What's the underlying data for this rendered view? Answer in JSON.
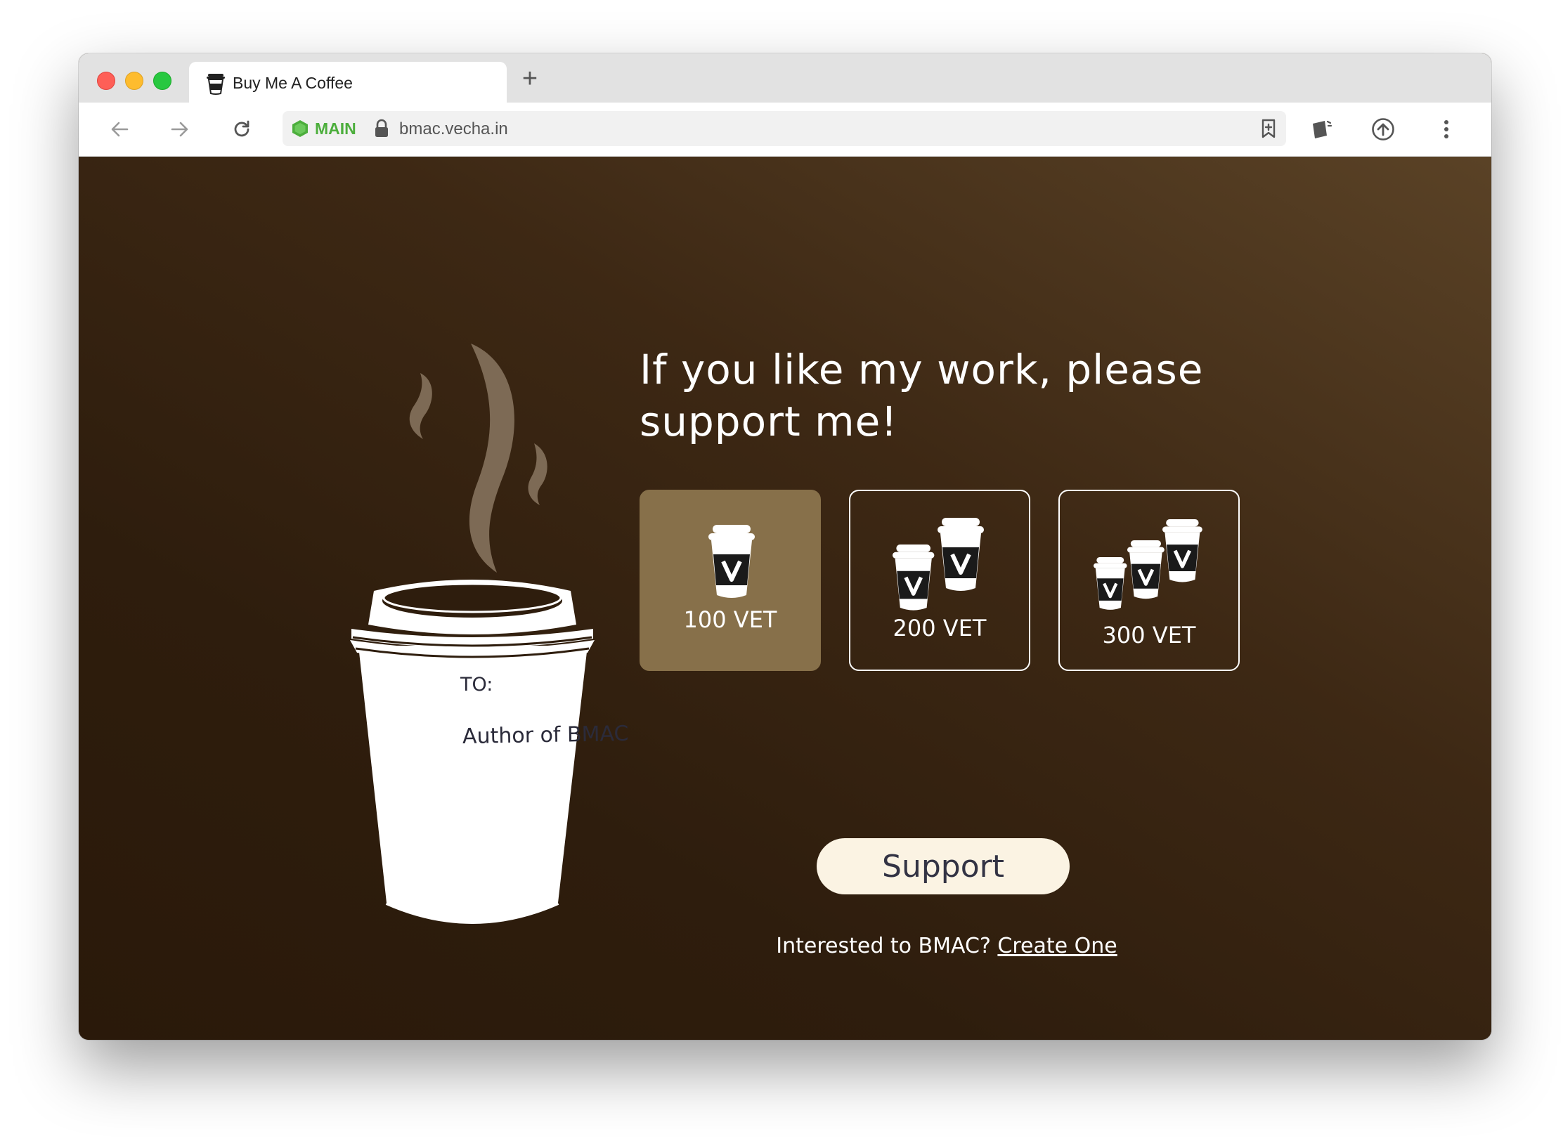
{
  "browser": {
    "tab_title": "Buy Me A Coffee",
    "new_tab_label": "+",
    "network_badge": "MAIN",
    "url": "bmac.vecha.in"
  },
  "page": {
    "headline_line1": "If you like my work, please",
    "headline_line2": "support me!",
    "cup_to_label": "TO:",
    "cup_recipient": "Author of BMAC",
    "options": [
      {
        "label": "100 VET",
        "cups": 1,
        "selected": true
      },
      {
        "label": "200 VET",
        "cups": 2,
        "selected": false
      },
      {
        "label": "300 VET",
        "cups": 3,
        "selected": false
      }
    ],
    "support_button": "Support",
    "footer_text": "Interested to BMAC?",
    "footer_link": "Create One"
  },
  "colors": {
    "background_dark": "#2e1d0d",
    "background_light": "#5a4226",
    "selected_option": "#87704a",
    "button_bg": "#fbf3e3",
    "network_badge": "#4cae3c"
  },
  "icons": [
    "coffee-cup-icon",
    "back-arrow-icon",
    "forward-arrow-icon",
    "reload-icon",
    "hexagon-icon",
    "lock-icon",
    "bookmark-icon",
    "wallet-icon",
    "upload-icon",
    "menu-dots-icon"
  ]
}
